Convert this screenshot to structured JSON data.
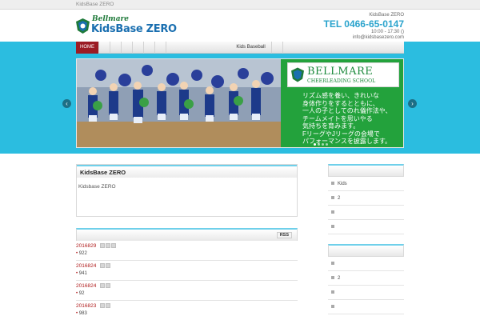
{
  "topbar": {
    "title": "KidsBase ZERO"
  },
  "header": {
    "logo_script": "Bellmare",
    "logo_name": "KidsBase ZERO",
    "contact_name": "KidsBase ZERO",
    "tel": "TEL 0466-65-0147",
    "hours": "10:00 - 17:30 ()",
    "email": "info@kidsbasezero.com"
  },
  "nav": {
    "home": "HOME",
    "baseball": "Kids Baseball"
  },
  "slider": {
    "badge_title": "BELLMARE",
    "badge_sub": "CHEERLEADING SCHOOL",
    "text_lines": [
      "リズム感を養い、きれいな",
      "身体作りをするとともに、",
      "一人の子としてのれ儀作法や、",
      "チームメイトを思いやる",
      "気持ちを育みます。",
      "FリーグやJリーグの会場で",
      "パフォーマンスを披露します。"
    ],
    "prev": "‹",
    "next": "›"
  },
  "main": {
    "title": "KidsBase ZERO",
    "body": "Kidsbase ZERO"
  },
  "news": {
    "rss": "RSS",
    "items": [
      {
        "date": "2016829",
        "count": "922"
      },
      {
        "date": "2016824",
        "count": "941"
      },
      {
        "date": "2016824",
        "count": "92"
      },
      {
        "date": "2016823",
        "count": "983"
      }
    ]
  },
  "sidebar": {
    "items1": [
      "Kids",
      "2",
      "",
      ""
    ],
    "items2": [
      "",
      "2",
      "",
      ""
    ]
  },
  "colors": {
    "accent": "#2bbde0",
    "nav_active": "#9b1c24",
    "tel": "#2aa3cc",
    "date": "#b01c1c",
    "slider_green": "#23a23c"
  }
}
